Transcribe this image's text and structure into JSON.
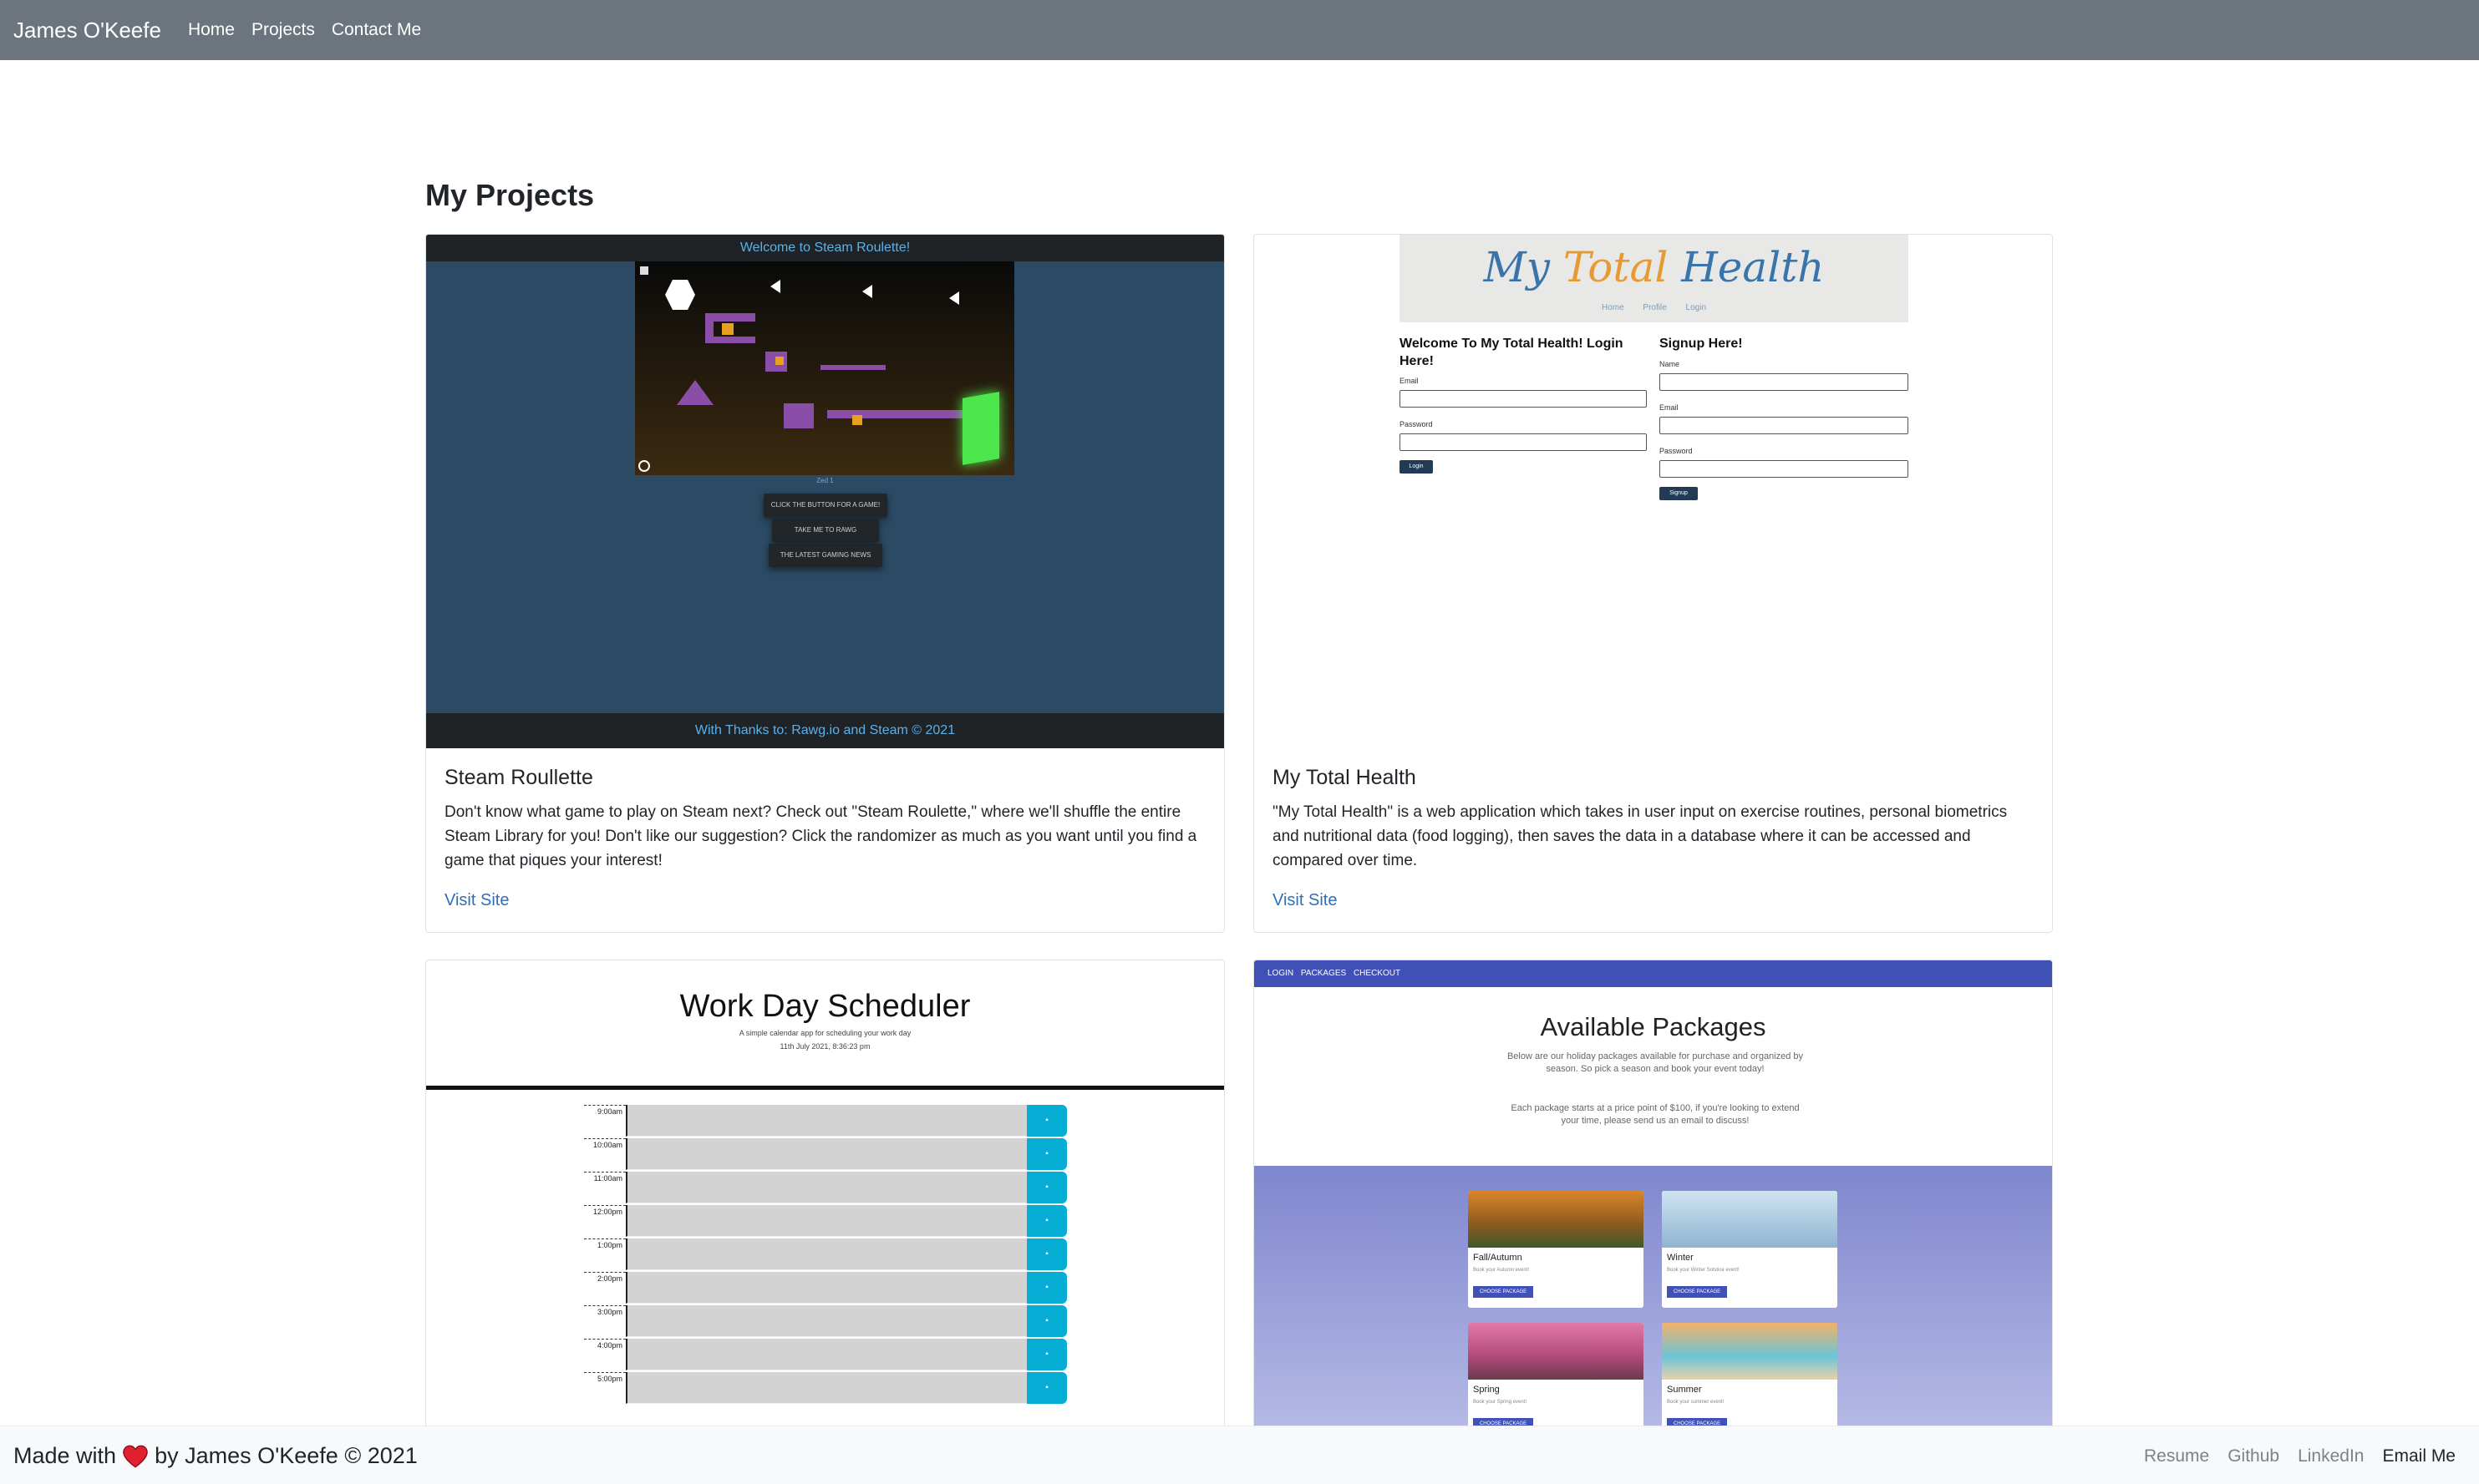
{
  "navbar": {
    "brand": "James O'Keefe",
    "links": [
      "Home",
      "Projects",
      "Contact Me"
    ]
  },
  "main": {
    "title": "My Projects",
    "projects": [
      {
        "title": "Steam Roullette",
        "description": "Don't know what game to play on Steam next? Check out \"Steam Roulette,\" where we'll shuffle the entire Steam Library for you! Don't like our suggestion? Click the randomizer as much as you want until you find a game that piques your interest!",
        "link": "Visit Site",
        "preview": {
          "header": "Welcome to Steam Roulette!",
          "footer": "With Thanks to: Rawg.io and Steam © 2021",
          "level_label": "Zed 1",
          "buttons": [
            "CLICK THE BUTTON FOR A GAME!",
            "TAKE ME TO RAWG",
            "THE LATEST GAMING NEWS"
          ]
        }
      },
      {
        "title": "My Total Health",
        "description": "\"My Total Health\" is a web application which takes in user input on exercise routines, personal biometrics and nutritional data (food logging), then saves the data in a database where it can be accessed and compared over time.",
        "link": "Visit Site",
        "preview": {
          "logo_a": "My ",
          "logo_b": "Total",
          "logo_c": " Health",
          "nav": "Home Profile Login",
          "login_heading": "Welcome To My Total Health! Login Here!",
          "signup_heading": "Signup Here!",
          "email_label": "Email",
          "password_label": "Password",
          "name_label": "Name",
          "login_button": "Login",
          "signup_button": "Signup"
        }
      },
      {
        "title": "Work Day Scheduler",
        "preview": {
          "title": "Work Day Scheduler",
          "subtitle": "A simple calendar app for scheduling your work day",
          "date": "11th July 2021, 8:36:23 pm",
          "hours": [
            "9:00am",
            "10:00am",
            "11:00am",
            "12:00pm",
            "1:00pm",
            "2:00pm",
            "3:00pm",
            "4:00pm",
            "5:00pm"
          ]
        }
      },
      {
        "title": "Available Packages",
        "preview": {
          "nav": "LOGIN PACKAGES CHECKOUT",
          "title": "Available Packages",
          "intro": "Below are our holiday packages available for purchase and organized by season. So pick a season and book your event today!",
          "intro2": "Each package starts at a price point of $100, if you're looking to extend your time, please send us an email to discuss!",
          "button": "CHOOSE PACKAGE",
          "packages": [
            {
              "name": "Fall/Autumn",
              "desc": "Book your Autumn event!"
            },
            {
              "name": "Winter",
              "desc": "Book your Winter Solstice event!"
            },
            {
              "name": "Spring",
              "desc": "Book your Spring event!"
            },
            {
              "name": "Summer",
              "desc": "Book your summer event!"
            }
          ]
        }
      }
    ]
  },
  "footer": {
    "made_with": "Made with",
    "by": "by James O'Keefe © 2021",
    "links": [
      "Resume",
      "Github",
      "LinkedIn",
      "Email Me"
    ]
  },
  "colors": {
    "navbar": "#6c757d",
    "link": "#2e6fb7",
    "heart": "#e0202e"
  }
}
